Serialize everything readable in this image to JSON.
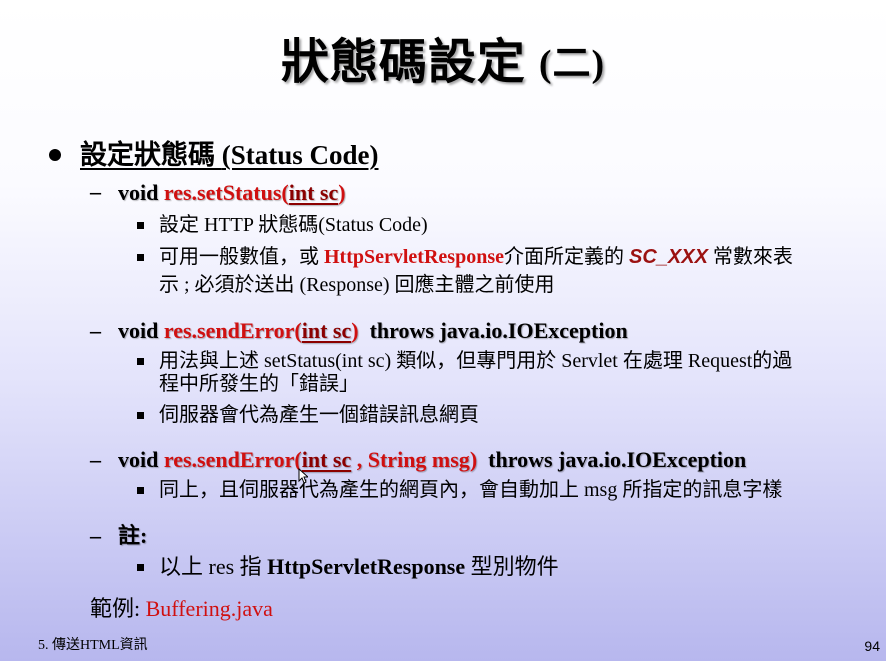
{
  "title": {
    "main": "狀態碼設定",
    "suffix": "(二)"
  },
  "content": {
    "bullet1": {
      "label_cn": "設定狀態碼",
      "label_en": "(Status Code)"
    },
    "item1": {
      "void": "void",
      "method": "res.setStatus",
      "open": "(",
      "param": "int sc",
      "close": ")"
    },
    "item1_subs": [
      "設定 HTTP 狀態碼(Status Code)",
      {
        "pre": "可用一般數值，或",
        "class_name": "HttpServletResponse",
        "mid": "介面所定義的",
        "sc": "SC_XXX",
        "post": "常數來表",
        "line2": "示 ; 必須於送出 (Response) 回應主體之前使用"
      }
    ],
    "item2": {
      "void": "void",
      "method": "res.sendError",
      "open": "(",
      "param": "int sc",
      "close": ")",
      "throws": "throws java.io.IOException"
    },
    "item2_subs": [
      {
        "line1": "用法與上述 setStatus(int sc) 類似，但專門用於 Servlet 在處理 Request的過",
        "line2": "程中所發生的「錯誤」"
      },
      "伺服器會代為產生一個錯誤訊息網頁"
    ],
    "item3": {
      "void": "void",
      "method": "res.sendError",
      "open": "(",
      "param": "int sc",
      "comma": ", String msg",
      "close": ")",
      "throws": "throws  java.io.IOException"
    },
    "item3_subs": [
      "同上，且伺服器代為產生的網頁內，會自動加上 msg 所指定的訊息字樣"
    ],
    "item4": {
      "label": "註:"
    },
    "item4_subs": {
      "pre": "以上 res 指",
      "class_name": "HttpServletResponse",
      "post": "型別物件"
    },
    "example": {
      "label": "範例:",
      "file": "Buffering.java"
    }
  },
  "footer": {
    "left": "5. 傳送HTML資訊",
    "right": "94"
  }
}
